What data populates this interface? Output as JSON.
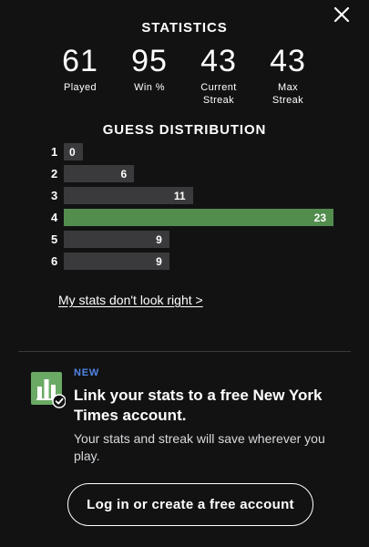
{
  "close": {
    "icon": "close-icon"
  },
  "statistics": {
    "heading": "STATISTICS",
    "items": [
      {
        "value": "61",
        "label": "Played"
      },
      {
        "value": "95",
        "label": "Win %"
      },
      {
        "value": "43",
        "label": "Current\nStreak"
      },
      {
        "value": "43",
        "label": "Max\nStreak"
      }
    ]
  },
  "distribution": {
    "heading": "GUESS DISTRIBUTION",
    "max": 23,
    "rows": [
      {
        "guess": "1",
        "count": "0"
      },
      {
        "guess": "2",
        "count": "6"
      },
      {
        "guess": "3",
        "count": "11"
      },
      {
        "guess": "4",
        "count": "23",
        "highlight": true
      },
      {
        "guess": "5",
        "count": "9"
      },
      {
        "guess": "6",
        "count": "9"
      }
    ],
    "colors": {
      "default": "#3a3a3c",
      "highlight": "#538d4e"
    }
  },
  "stats_link": "My stats don't look right >",
  "promo": {
    "icon": "stats-chart-check-icon",
    "badge": "NEW",
    "title": "Link your stats to a free New York Times account.",
    "description": "Your stats and streak will save wherever you play.",
    "button_label": "Log in or create a free account",
    "accent_color": "#4f85e5",
    "icon_color": "#6aaa64"
  }
}
